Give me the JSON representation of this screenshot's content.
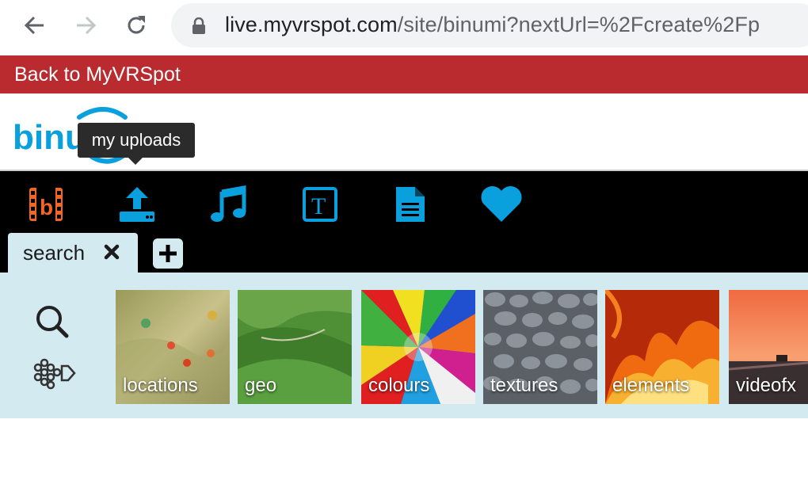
{
  "browser": {
    "url_host": "live.myvrspot.com",
    "url_path": "/site/binumi?nextUrl=%2Fcreate%2Fp"
  },
  "banner": {
    "back_label": "Back to MyVRSpot"
  },
  "logo": {
    "text": "binumi"
  },
  "tooltip": {
    "text": "my uploads"
  },
  "tabs": {
    "search_label": "search"
  },
  "tiles": [
    {
      "label": "locations"
    },
    {
      "label": "geo"
    },
    {
      "label": "colours"
    },
    {
      "label": "textures"
    },
    {
      "label": "elements"
    },
    {
      "label": "videofx"
    }
  ],
  "colors": {
    "accent_blue": "#0aa0de",
    "banner_red": "#b92b2f",
    "panel_bg": "#d3eaf0",
    "brand_orange": "#f26522"
  }
}
